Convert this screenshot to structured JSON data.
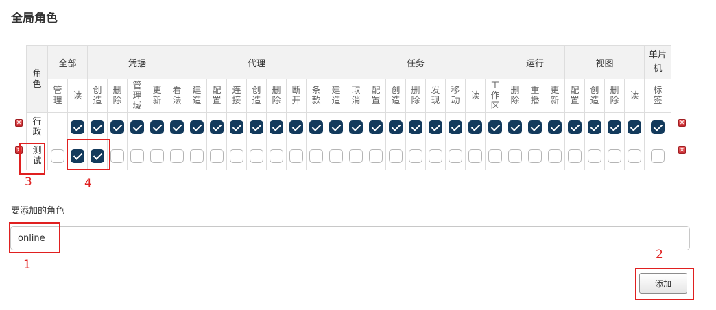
{
  "page_title": "全局角色",
  "matrix": {
    "role_header": "角色",
    "groups": [
      {
        "label": "全部",
        "span": 2
      },
      {
        "label": "凭据",
        "span": 5
      },
      {
        "label": "代理",
        "span": 7
      },
      {
        "label": "任务",
        "span": 9
      },
      {
        "label": "运行",
        "span": 3
      },
      {
        "label": "视图",
        "span": 4
      },
      {
        "label": "单片机",
        "span": 1
      }
    ],
    "permissions": [
      "管理",
      "读",
      "创造",
      "删除",
      "管理域",
      "更新",
      "看法",
      "建造",
      "配置",
      "连接",
      "创造",
      "删除",
      "断开",
      "条款",
      "建造",
      "取消",
      "配置",
      "创造",
      "删除",
      "发现",
      "移动",
      "读",
      "工作区",
      "删除",
      "重播",
      "更新",
      "配置",
      "创造",
      "删除",
      "读",
      "标签"
    ],
    "roles": [
      {
        "name": "行政",
        "checked": [
          false,
          true,
          true,
          true,
          true,
          true,
          true,
          true,
          true,
          true,
          true,
          true,
          true,
          true,
          true,
          true,
          true,
          true,
          true,
          true,
          true,
          true,
          true,
          true,
          true,
          true,
          true,
          true,
          true,
          true,
          true
        ],
        "empty_first": true
      },
      {
        "name": "测试",
        "checked": [
          false,
          true,
          true,
          false,
          false,
          false,
          false,
          false,
          false,
          false,
          false,
          false,
          false,
          false,
          false,
          false,
          false,
          false,
          false,
          false,
          false,
          false,
          false,
          false,
          false,
          false,
          false,
          false,
          false,
          false,
          false
        ],
        "empty_first": false
      }
    ],
    "delete_icon": "✕"
  },
  "add_role": {
    "label": "要添加的角色",
    "value": "online",
    "button_label": "添加"
  },
  "annotations": [
    "1",
    "2",
    "3",
    "4"
  ],
  "colors": {
    "checked": "#133a5c",
    "annotation": "#e02020"
  }
}
